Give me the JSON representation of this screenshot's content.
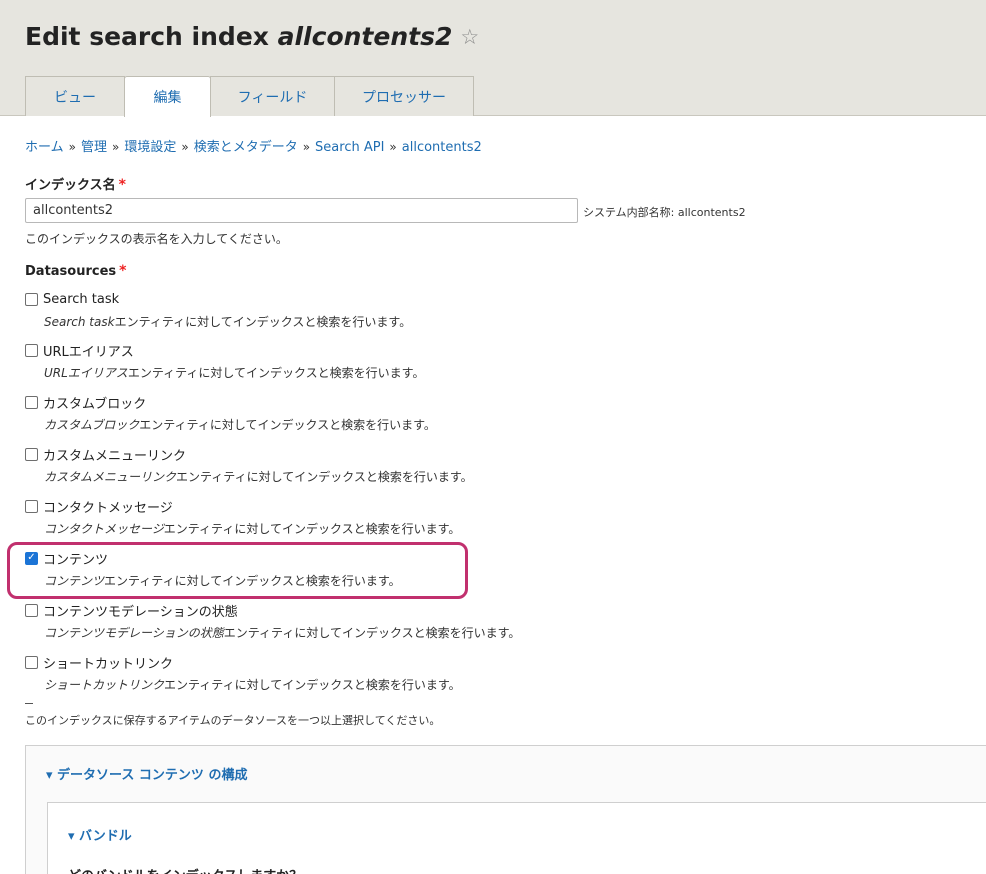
{
  "header": {
    "title_prefix": "Edit search index ",
    "title_name": "allcontents2",
    "star_icon": "star-outline-icon",
    "tabs": [
      {
        "label": "ビュー",
        "active": false
      },
      {
        "label": "編集",
        "active": true
      },
      {
        "label": "フィールド",
        "active": false
      },
      {
        "label": "プロセッサー",
        "active": false
      }
    ]
  },
  "breadcrumb": {
    "items": [
      "ホーム",
      "管理",
      "環境設定",
      "検索とメタデータ",
      "Search API",
      "allcontents2"
    ],
    "separator": "»"
  },
  "form": {
    "index_name": {
      "label": "インデックス名",
      "required_mark": "*",
      "value": "allcontents2",
      "machine_name": "システム内部名称: allcontents2",
      "description": "このインデックスの表示名を入力してください。"
    },
    "datasources": {
      "label": "Datasources",
      "required_mark": "*",
      "items": [
        {
          "title": "Search task",
          "desc_em": "Search task",
          "desc_rest": "エンティティに対してインデックスと検索を行います。",
          "checked": false
        },
        {
          "title": "URLエイリアス",
          "desc_em": "URLエイリアス",
          "desc_rest": "エンティティに対してインデックスと検索を行います。",
          "checked": false
        },
        {
          "title": "カスタムブロック",
          "desc_em": "カスタムブロック",
          "desc_rest": "エンティティに対してインデックスと検索を行います。",
          "checked": false
        },
        {
          "title": "カスタムメニューリンク",
          "desc_em": "カスタムメニューリンク",
          "desc_rest": "エンティティに対してインデックスと検索を行います。",
          "checked": false
        },
        {
          "title": "コンタクトメッセージ",
          "desc_em": "コンタクトメッセージ",
          "desc_rest": "エンティティに対してインデックスと検索を行います。",
          "checked": false
        },
        {
          "title": "コンテンツ",
          "desc_em": "コンテンツ",
          "desc_rest": "エンティティに対してインデックスと検索を行います。",
          "checked": true
        },
        {
          "title": "コンテンツモデレーションの状態",
          "desc_em": "コンテンツモデレーションの状態",
          "desc_rest": "エンティティに対してインデックスと検索を行います。",
          "checked": false
        },
        {
          "title": "ショートカットリンク",
          "desc_em": "ショートカットリンク",
          "desc_rest": "エンティティに対してインデックスと検索を行います。",
          "checked": false
        }
      ],
      "description": "このインデックスに保存するアイテムのデータソースを一つ以上選択してください。"
    }
  },
  "config": {
    "title": "▾ データソース コンテンツ の構成",
    "bundle": {
      "title": "▾ バンドル",
      "question": "どのバンドルをインデックスしますか？"
    }
  }
}
